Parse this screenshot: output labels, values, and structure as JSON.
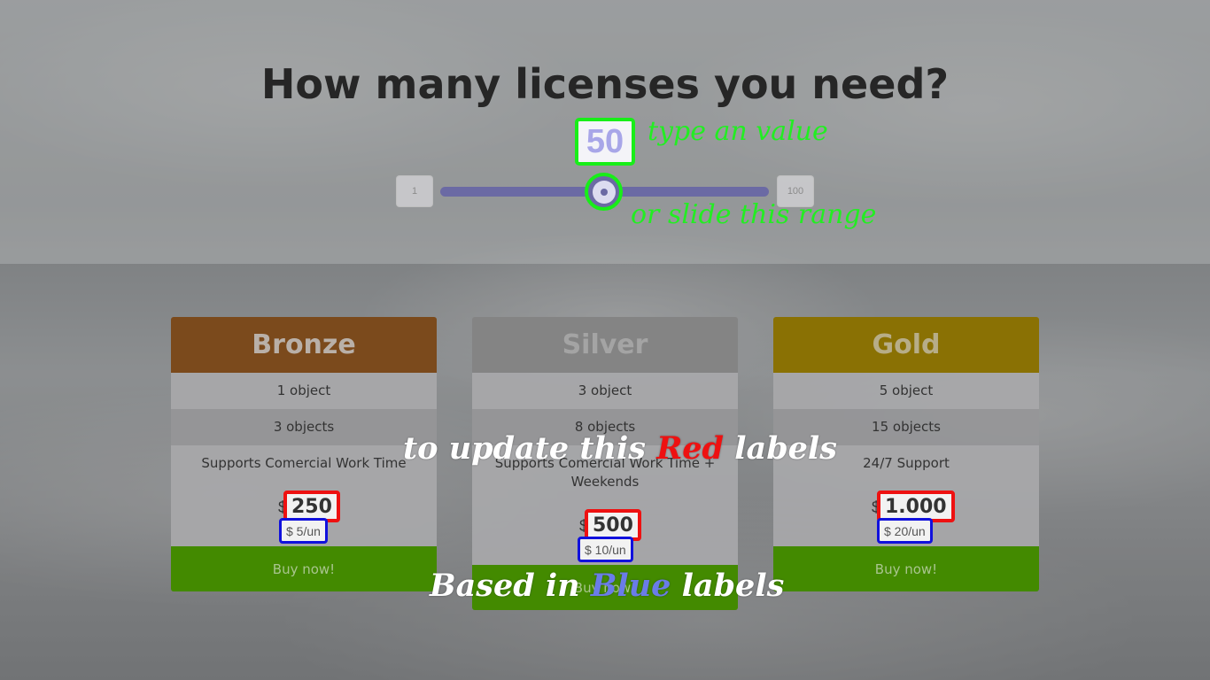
{
  "headline": "How many licenses you need?",
  "quantity": {
    "value": "50"
  },
  "range": {
    "min_label": "1",
    "max_label": "100",
    "min": 1,
    "max": 100,
    "value": 50
  },
  "hints": {
    "type_value": "type an value",
    "slide_range": "or slide this range"
  },
  "plans": [
    {
      "name": "Bronze",
      "features": [
        "1 object",
        "3 objects",
        "Supports Comercial Work Time"
      ],
      "currency": "$",
      "total": "250",
      "unit_price": "$ 5/un",
      "buy_label": "Buy now!"
    },
    {
      "name": "Silver",
      "features": [
        "3 object",
        "8 objects",
        "Supports Comercial Work Time + Weekends"
      ],
      "currency": "$",
      "total": "500",
      "unit_price": "$ 10/un",
      "buy_label": "Buy now!"
    },
    {
      "name": "Gold",
      "features": [
        "5 object",
        "15 objects",
        "24/7 Support"
      ],
      "currency": "$",
      "total": "1.000",
      "unit_price": "$ 20/un",
      "buy_label": "Buy now!"
    }
  ],
  "overlays": {
    "update_prefix": "to update this",
    "update_highlight": "Red",
    "update_suffix": "labels",
    "based_prefix": "Based in",
    "based_highlight": "Blue",
    "based_suffix": "labels"
  },
  "colors": {
    "bronze": "#7b4a1c",
    "silver": "#848484",
    "gold": "#8a7104",
    "buy": "#438a00",
    "slider": "#6b6aa4",
    "highlight_green": "#18ee18",
    "highlight_red": "#ee1111",
    "highlight_blue": "#1111dd"
  }
}
